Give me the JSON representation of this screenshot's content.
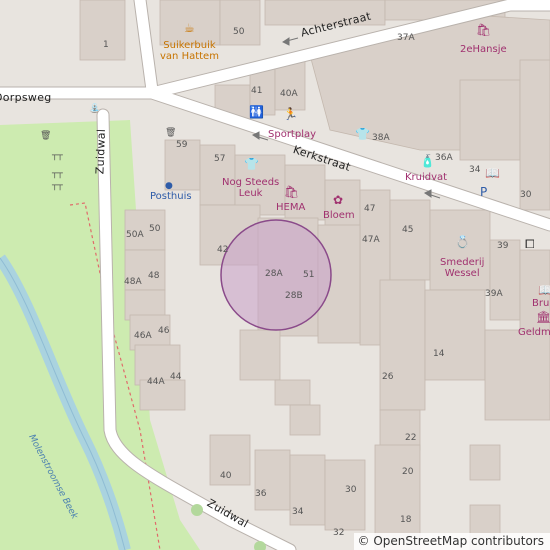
{
  "map": {
    "streets": {
      "achterstraat": "Achterstraat",
      "kerkstraat": "Kerkstraat",
      "zuidwal_west": "Zuidwal",
      "zuidwal_south": "Zuidwal",
      "dorpsweg": "Dorpsweg"
    },
    "pois": {
      "suikerbuik": "Suikerbuik\nvan Hattem",
      "zehansje": "2eHansje",
      "sportplay": "Sportplay",
      "kruidvat": "Kruidvat",
      "nog_steeds_leuk": "Nog Steeds\nLeuk",
      "hema": "HEMA",
      "bloem": "Bloem",
      "posthuis": "Posthuis",
      "smederij_wessel": "Smederij\nWessel",
      "bru": "Bru",
      "geldm": "Geldm"
    },
    "waterway": "Molenstroomse Beek",
    "house_numbers": [
      "1",
      "50",
      "37A",
      "41",
      "40A",
      "38A",
      "59",
      "57",
      "36A",
      "34",
      "30",
      "47",
      "47A",
      "45",
      "39",
      "42",
      "28A",
      "51",
      "28B",
      "50A",
      "50",
      "48A",
      "48",
      "46A",
      "46",
      "44A",
      "44",
      "39A",
      "14",
      "26",
      "22",
      "20",
      "40",
      "36",
      "34",
      "30",
      "32",
      "18"
    ],
    "highlight_color": "#c9a0c9",
    "accent_color": "#a0316f",
    "attribution": "© OpenStreetMap contributors"
  }
}
